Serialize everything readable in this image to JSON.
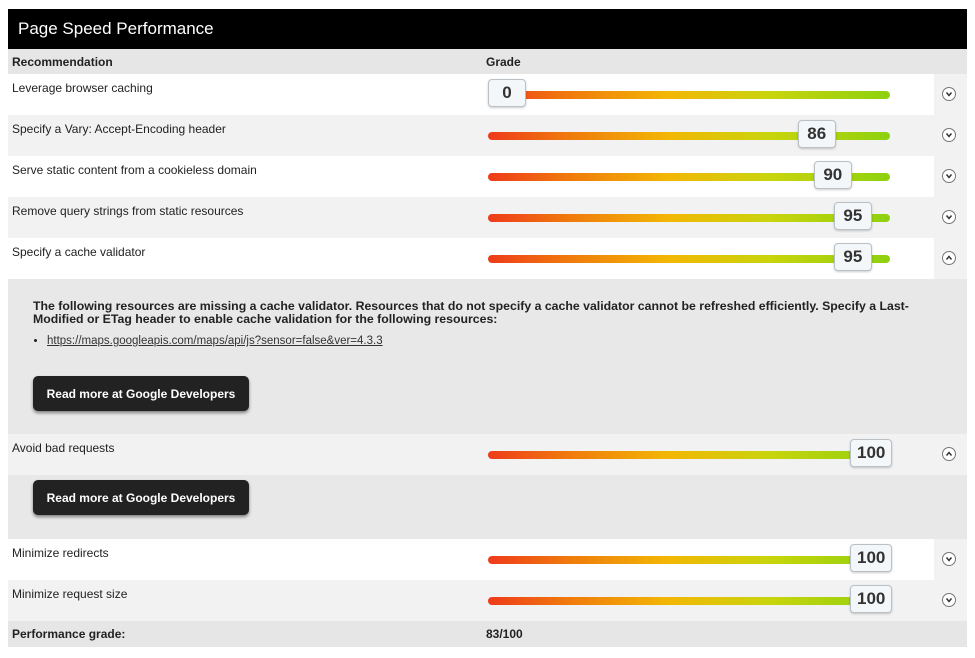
{
  "title": "Page Speed Performance",
  "columns": {
    "recommendation": "Recommendation",
    "grade": "Grade"
  },
  "rows": [
    {
      "label": "Leverage browser caching",
      "grade": "0",
      "expanded": false
    },
    {
      "label": "Specify a Vary: Accept-Encoding header",
      "grade": "86",
      "expanded": false
    },
    {
      "label": "Serve static content from a cookieless domain",
      "grade": "90",
      "expanded": false
    },
    {
      "label": "Remove query strings from static resources",
      "grade": "95",
      "expanded": false
    },
    {
      "label": "Specify a cache validator",
      "grade": "95",
      "expanded": true
    },
    {
      "label": "Avoid bad requests",
      "grade": "100",
      "expanded": true
    },
    {
      "label": "Minimize redirects",
      "grade": "100",
      "expanded": false
    },
    {
      "label": "Minimize request size",
      "grade": "100",
      "expanded": false
    }
  ],
  "cache_validator_detail": {
    "text": "The following resources are missing a cache validator. Resources that do not specify a cache validator cannot be refreshed efficiently. Specify a Last-Modified or ETag header to enable cache validation for the following resources:",
    "resources": [
      "https://maps.googleapis.com/maps/api/js?sensor=false&ver=4.3.3"
    ],
    "button": "Read more at Google Developers"
  },
  "bad_requests_detail": {
    "button": "Read more at Google Developers"
  },
  "footer": {
    "label": "Performance grade:",
    "value": "83/100"
  },
  "icons": {
    "expand": "chevron-down-icon",
    "collapse": "chevron-up-icon"
  },
  "colors": {
    "bar_start": "#ee3b1b",
    "bar_mid": "#f2b705",
    "bar_end": "#8ed10f",
    "title_bg": "#000000"
  }
}
